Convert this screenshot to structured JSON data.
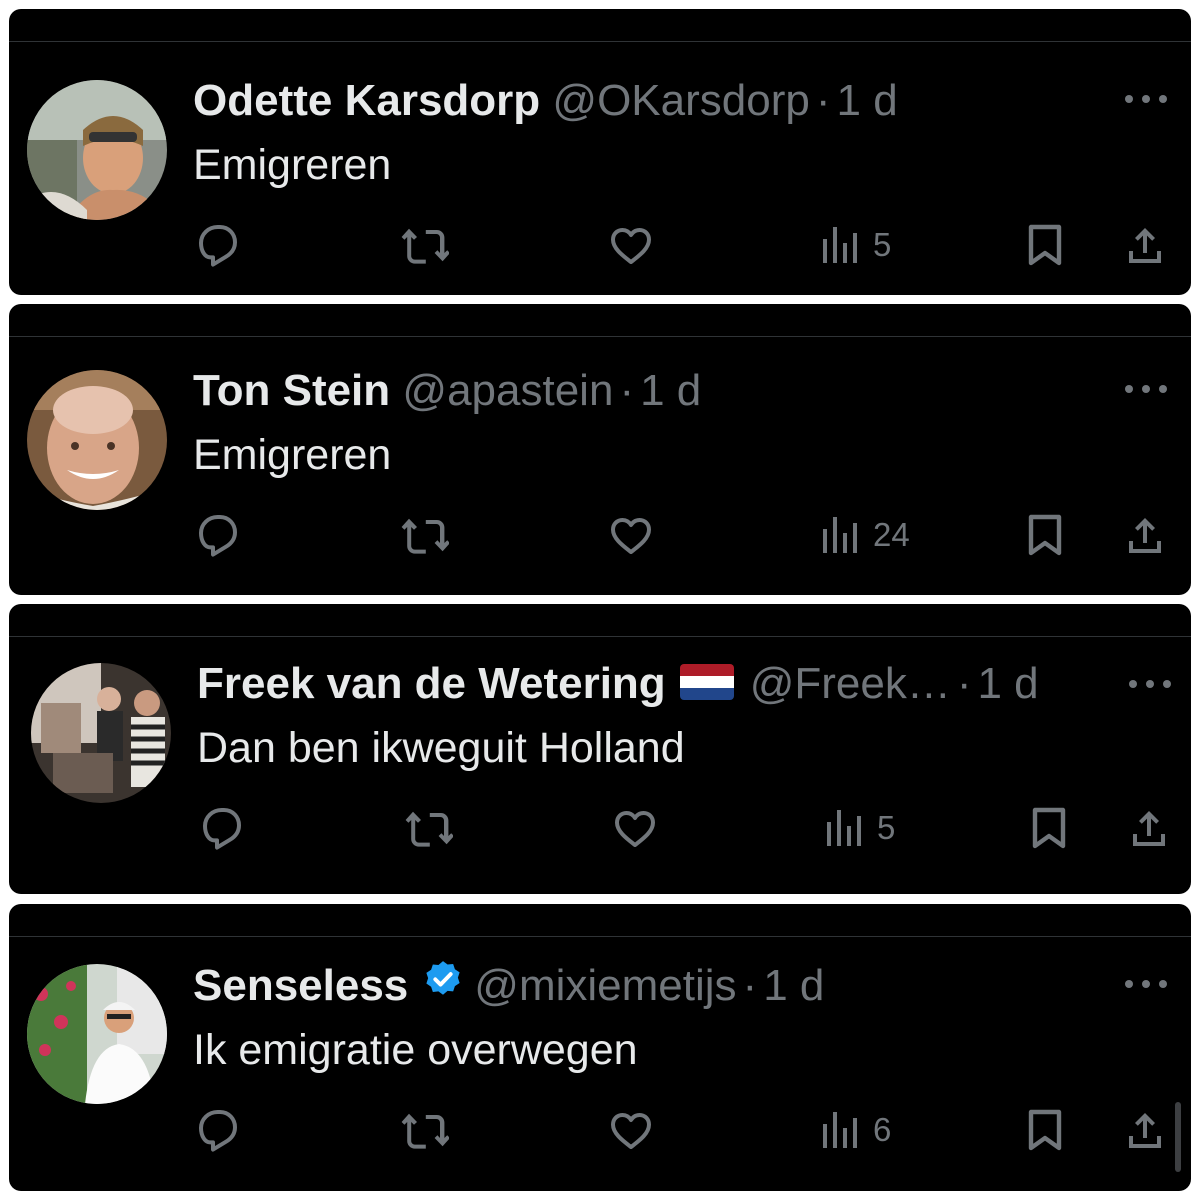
{
  "tweets": [
    {
      "name": "Odette Karsdorp",
      "handle": "@OKarsdorp",
      "separator": "·",
      "time": "1 d",
      "text": "Emigreren",
      "views": "5"
    },
    {
      "name": "Ton Stein",
      "handle": "@apastein",
      "separator": "·",
      "time": "1 d",
      "text": "Emigreren",
      "views": "24"
    },
    {
      "name": "Freek van de Wetering",
      "flag": "netherlands-flag",
      "handle": "@Freek…",
      "separator": "·",
      "time": "1 d",
      "text": "Dan ben ikweguit Holland",
      "views": "5"
    },
    {
      "name": "Senseless",
      "verified_badge": "verified-icon",
      "handle": "@mixiemetijs",
      "separator": "·",
      "time": "1 d",
      "text": "Ik emigratie overwegen",
      "views": "6"
    }
  ],
  "icons": {
    "reply": "reply-icon",
    "retweet": "retweet-icon",
    "like": "heart-icon",
    "views": "views-icon",
    "bookmark": "bookmark-icon",
    "share": "share-icon",
    "more": "more-icon"
  },
  "colors": {
    "background": "#000000",
    "primary_text": "#e7e9ea",
    "secondary_text": "#71767b",
    "verified": "#1d9bf0",
    "divider": "#2f3336"
  }
}
